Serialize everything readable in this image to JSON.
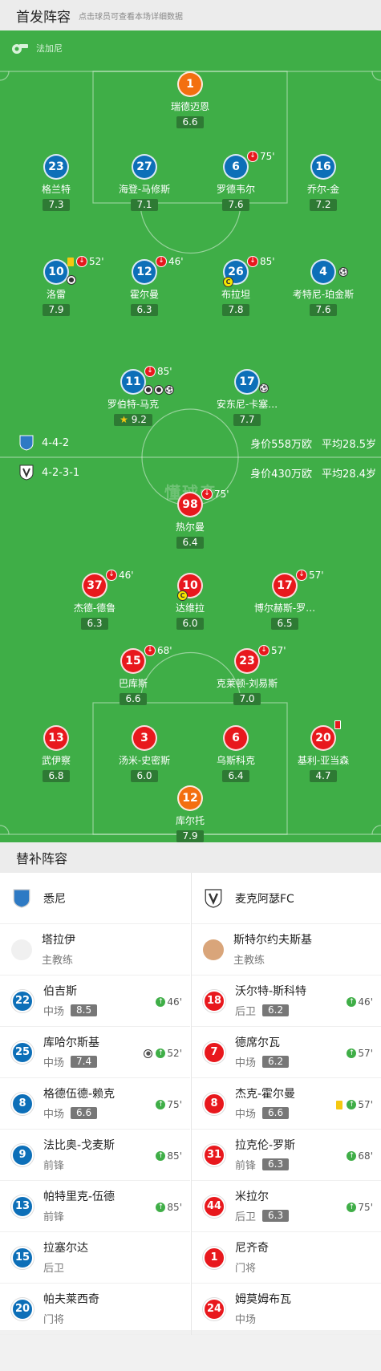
{
  "header": {
    "title": "首发阵容",
    "subtitle": "点击球员可查看本场详细数据"
  },
  "referee": {
    "icon": "whistle-icon",
    "name": "法加尼"
  },
  "watermark": "懂球帝",
  "home": {
    "shield_icon": "sydney-fc-shield-icon",
    "formation": "4-4-2",
    "value": "身价558万欧",
    "avg_age": "平均28.5岁",
    "players": [
      {
        "num": "1",
        "name": "瑞德迈恩",
        "rating": "6.6",
        "color": "orange"
      },
      {
        "num": "23",
        "name": "格兰特",
        "rating": "7.3",
        "color": "blue"
      },
      {
        "num": "27",
        "name": "海登-马修斯",
        "rating": "7.1",
        "color": "blue"
      },
      {
        "num": "6",
        "name": "罗德韦尔",
        "rating": "7.6",
        "color": "blue",
        "off": "75'"
      },
      {
        "num": "16",
        "name": "乔尔-金",
        "rating": "7.2",
        "color": "blue"
      },
      {
        "num": "10",
        "name": "洛雷",
        "rating": "7.9",
        "color": "blue",
        "off": "52'"
      },
      {
        "num": "12",
        "name": "霍尔曼",
        "rating": "6.3",
        "color": "blue",
        "off": "46'"
      },
      {
        "num": "26",
        "name": "布拉坦",
        "rating": "7.8",
        "color": "blue",
        "off": "85'"
      },
      {
        "num": "4",
        "name": "考特尼-珀金斯",
        "rating": "7.6",
        "color": "blue"
      },
      {
        "num": "11",
        "name": "罗伯特-马克",
        "rating": "9.2",
        "color": "blue",
        "off": "85'"
      },
      {
        "num": "17",
        "name": "安东尼-卡塞…",
        "rating": "7.7",
        "color": "blue"
      }
    ]
  },
  "away": {
    "shield_icon": "macarthur-fc-shield-icon",
    "formation": "4-2-3-1",
    "value": "身价430万欧",
    "avg_age": "平均28.4岁",
    "players": [
      {
        "num": "98",
        "name": "热尔曼",
        "rating": "6.4",
        "color": "red",
        "off": "75'"
      },
      {
        "num": "37",
        "name": "杰德-德鲁",
        "rating": "6.3",
        "color": "red",
        "off": "46'"
      },
      {
        "num": "10",
        "name": "达维拉",
        "rating": "6.0",
        "color": "red"
      },
      {
        "num": "17",
        "name": "博尔赫斯-罗…",
        "rating": "6.5",
        "color": "red",
        "off": "57'"
      },
      {
        "num": "15",
        "name": "巴库斯",
        "rating": "6.6",
        "color": "red",
        "off": "68'"
      },
      {
        "num": "23",
        "name": "克莱顿-刘易斯",
        "rating": "7.0",
        "color": "red",
        "off": "57'"
      },
      {
        "num": "13",
        "name": "武伊察",
        "rating": "6.8",
        "color": "red"
      },
      {
        "num": "3",
        "name": "汤米-史密斯",
        "rating": "6.0",
        "color": "red"
      },
      {
        "num": "6",
        "name": "乌斯科克",
        "rating": "6.4",
        "color": "red"
      },
      {
        "num": "20",
        "name": "基利-亚当森",
        "rating": "4.7",
        "color": "red"
      },
      {
        "num": "12",
        "name": "库尔托",
        "rating": "7.9",
        "color": "orange"
      }
    ]
  },
  "bench": {
    "title": "替补阵容",
    "home_team": "悉尼",
    "away_team": "麦克阿瑟FC",
    "home_coach": {
      "name": "塔拉伊",
      "role": "主教练"
    },
    "away_coach": {
      "name": "斯特尔约夫斯基",
      "role": "主教练"
    },
    "home": [
      {
        "num": "22",
        "name": "伯吉斯",
        "pos": "中场",
        "rating": "8.5",
        "on": "46'"
      },
      {
        "num": "25",
        "name": "库哈尔斯基",
        "pos": "中场",
        "rating": "7.4",
        "on": "52'"
      },
      {
        "num": "8",
        "name": "格德伍德-赖克",
        "pos": "中场",
        "rating": "6.6",
        "on": "75'"
      },
      {
        "num": "9",
        "name": "法比奥-戈麦斯",
        "pos": "前锋",
        "rating": "",
        "on": "85'"
      },
      {
        "num": "13",
        "name": "帕特里克-伍德",
        "pos": "前锋",
        "rating": "",
        "on": "85'"
      },
      {
        "num": "15",
        "name": "拉塞尔达",
        "pos": "后卫",
        "rating": "",
        "on": ""
      },
      {
        "num": "20",
        "name": "帕夫莱西奇",
        "pos": "门将",
        "rating": "",
        "on": ""
      }
    ],
    "away": [
      {
        "num": "18",
        "name": "沃尔特-斯科特",
        "pos": "后卫",
        "rating": "6.2",
        "on": "46'"
      },
      {
        "num": "7",
        "name": "德席尔瓦",
        "pos": "中场",
        "rating": "6.2",
        "on": "57'"
      },
      {
        "num": "8",
        "name": "杰克-霍尔曼",
        "pos": "中场",
        "rating": "6.6",
        "on": "57'"
      },
      {
        "num": "31",
        "name": "拉克伦-罗斯",
        "pos": "前锋",
        "rating": "6.3",
        "on": "68'"
      },
      {
        "num": "44",
        "name": "米拉尔",
        "pos": "后卫",
        "rating": "6.3",
        "on": "75'"
      },
      {
        "num": "1",
        "name": "尼齐奇",
        "pos": "门将",
        "rating": "",
        "on": ""
      },
      {
        "num": "24",
        "name": "姆莫姆布瓦",
        "pos": "中场",
        "rating": "",
        "on": ""
      }
    ]
  }
}
